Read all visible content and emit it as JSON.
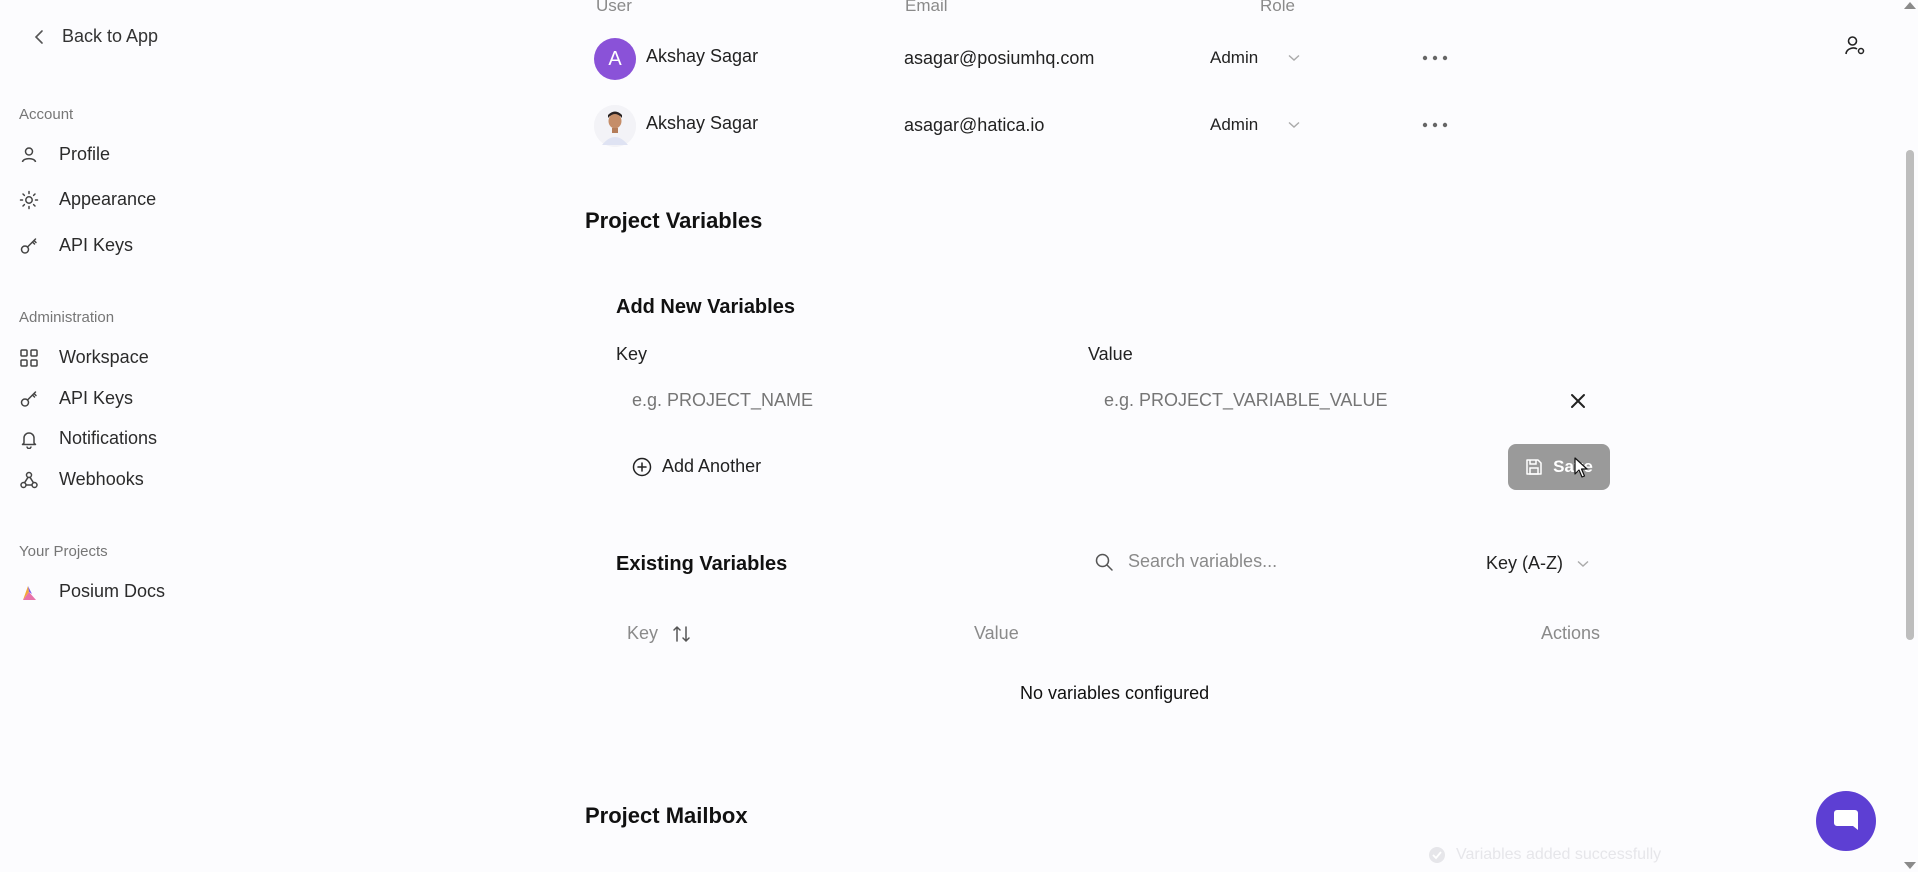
{
  "sidebar": {
    "back_label": "Back to App",
    "sections": [
      {
        "label": "Account",
        "items": [
          "Profile",
          "Appearance",
          "API Keys"
        ]
      },
      {
        "label": "Administration",
        "items": [
          "Workspace",
          "API Keys",
          "Notifications",
          "Webhooks"
        ]
      },
      {
        "label": "Your Projects",
        "items": [
          "Posium Docs"
        ]
      }
    ]
  },
  "users_table": {
    "headers": [
      "User",
      "Email",
      "Role"
    ],
    "rows": [
      {
        "initial": "A",
        "name": "Akshay Sagar",
        "email": "asagar@posiumhq.com",
        "role": "Admin"
      },
      {
        "initial": "",
        "name": "Akshay Sagar",
        "email": "asagar@hatica.io",
        "role": "Admin"
      }
    ]
  },
  "project_variables": {
    "title": "Project Variables",
    "add_new": {
      "title": "Add New Variables",
      "key_label": "Key",
      "value_label": "Value",
      "key_placeholder": "e.g. PROJECT_NAME",
      "value_placeholder": "e.g. PROJECT_VARIABLE_VALUE",
      "add_another_label": "Add Another",
      "save_label": "Save"
    },
    "existing": {
      "title": "Existing Variables",
      "search_placeholder": "Search variables...",
      "sort_label": "Key (A-Z)",
      "headers": [
        "Key",
        "Value",
        "Actions"
      ],
      "empty_message": "No variables configured"
    }
  },
  "project_mailbox": {
    "title": "Project Mailbox"
  },
  "toast": {
    "message": "Variables added successfully"
  },
  "colors": {
    "accent": "#5d3fd3",
    "avatar_purple": "#8a52d8",
    "save_disabled": "#9a9a9a"
  }
}
